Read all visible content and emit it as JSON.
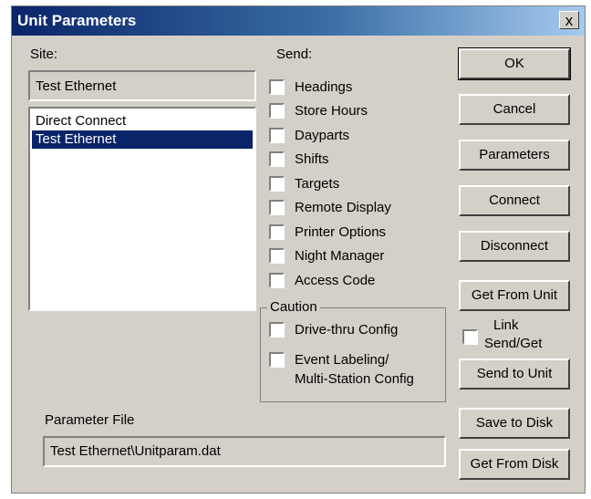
{
  "window": {
    "title": "Unit Parameters",
    "close_glyph": "x"
  },
  "site": {
    "label": "Site:",
    "current_value": "Test Ethernet",
    "list": [
      "Direct Connect",
      "Test Ethernet"
    ],
    "selected_index": 1
  },
  "send": {
    "label": "Send:",
    "items": [
      "Headings",
      "Store Hours",
      "Dayparts",
      "Shifts",
      "Targets",
      "Remote Display",
      "Printer Options",
      "Night Manager",
      "Access Code"
    ]
  },
  "caution": {
    "label": "Caution",
    "drive_thru": "Drive-thru Config",
    "event_line1": "Event Labeling/",
    "event_line2": "Multi-Station  Config"
  },
  "buttons": {
    "ok": "OK",
    "cancel": "Cancel",
    "parameters": "Parameters",
    "connect": "Connect",
    "disconnect": "Disconnect",
    "get_from_unit": "Get From Unit",
    "send_to_unit": "Send to Unit",
    "save_to_disk": "Save to Disk",
    "get_from_disk": "Get From Disk"
  },
  "link": {
    "line1": "Link",
    "line2": "Send/Get"
  },
  "parameter_file": {
    "label": "Parameter File",
    "value": "Test Ethernet\\Unitparam.dat"
  }
}
